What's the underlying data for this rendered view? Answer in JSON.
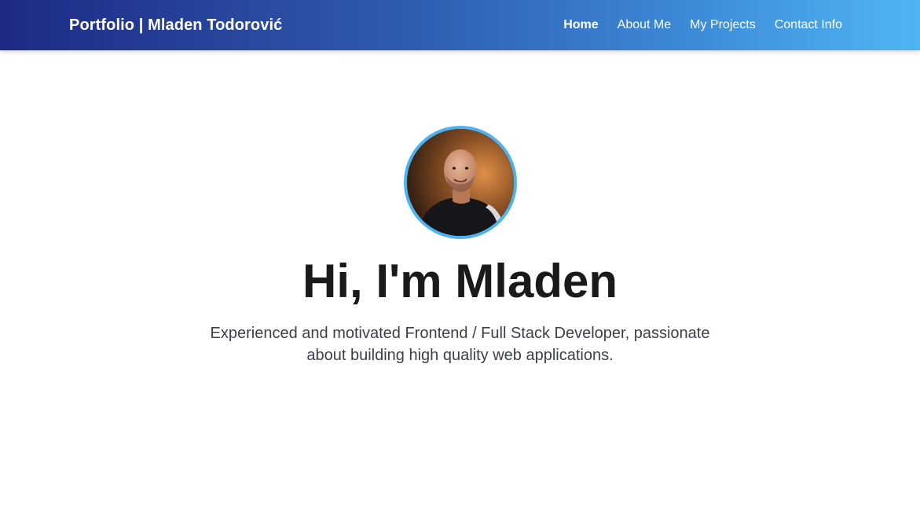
{
  "header": {
    "brand": "Portfolio | Mladen Todorović",
    "nav": [
      {
        "label": "Home",
        "active": true
      },
      {
        "label": "About Me",
        "active": false
      },
      {
        "label": "My Projects",
        "active": false
      },
      {
        "label": "Contact Info",
        "active": false
      }
    ]
  },
  "hero": {
    "avatar_icon": "profile-photo",
    "headline": "Hi, I'm Mladen",
    "tagline": "Experienced and motivated Frontend / Full Stack Developer, passionate about building high quality web applications."
  },
  "colors": {
    "nav_gradient_start": "#1e2a84",
    "nav_gradient_end": "#4fb6f2",
    "avatar_border": "#4db3f0",
    "headline": "#1a1a1a",
    "tagline": "#3a3f4a"
  }
}
